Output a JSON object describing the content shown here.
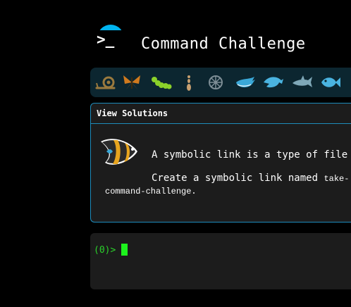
{
  "app": {
    "title": "Command Challenge",
    "logo_symbol": ">_",
    "accent_color": "#00b4f0"
  },
  "levels": [
    {
      "icon": "snail-icon"
    },
    {
      "icon": "butterfly-icon"
    },
    {
      "icon": "caterpillar-icon"
    },
    {
      "icon": "ant-icon"
    },
    {
      "icon": "sand-dollar-icon"
    },
    {
      "icon": "whale-icon"
    },
    {
      "icon": "dolphin-icon"
    },
    {
      "icon": "shark-icon"
    },
    {
      "icon": "fish-icon"
    }
  ],
  "challenge": {
    "solutions_label": "View Solutions",
    "icon": "angelfish-icon",
    "description": "A symbolic link is a type of file",
    "task_prefix": "Create a symbolic link named ",
    "task_code_start": "take-",
    "task_code_rest": "command-challenge",
    "task_suffix": "."
  },
  "terminal": {
    "prompt": "(0)>",
    "prompt_color": "#2bd22b"
  }
}
